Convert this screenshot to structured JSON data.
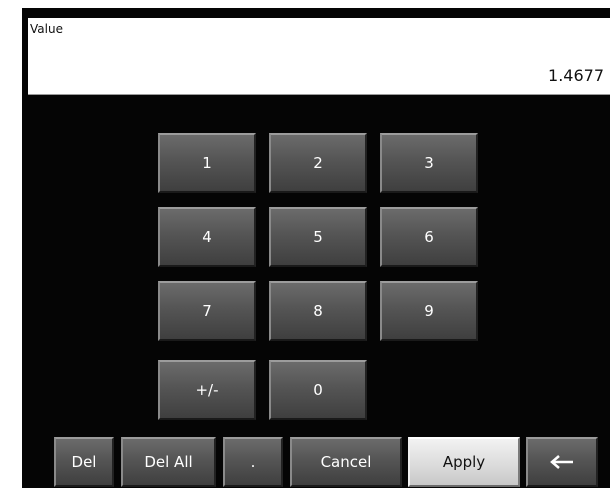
{
  "display": {
    "label": "Value",
    "value": "1.4677"
  },
  "keypad": {
    "k1": "1",
    "k2": "2",
    "k3": "3",
    "k4": "4",
    "k5": "5",
    "k6": "6",
    "k7": "7",
    "k8": "8",
    "k9": "9",
    "plusminus": "+/-",
    "k0": "0"
  },
  "actions": {
    "del": "Del",
    "del_all": "Del All",
    "decimal": ".",
    "cancel": "Cancel",
    "apply": "Apply",
    "backspace_icon": "left-arrow-icon"
  },
  "colors": {
    "panel": "#050505",
    "key": "#555555",
    "apply": "#dcdcdc"
  }
}
